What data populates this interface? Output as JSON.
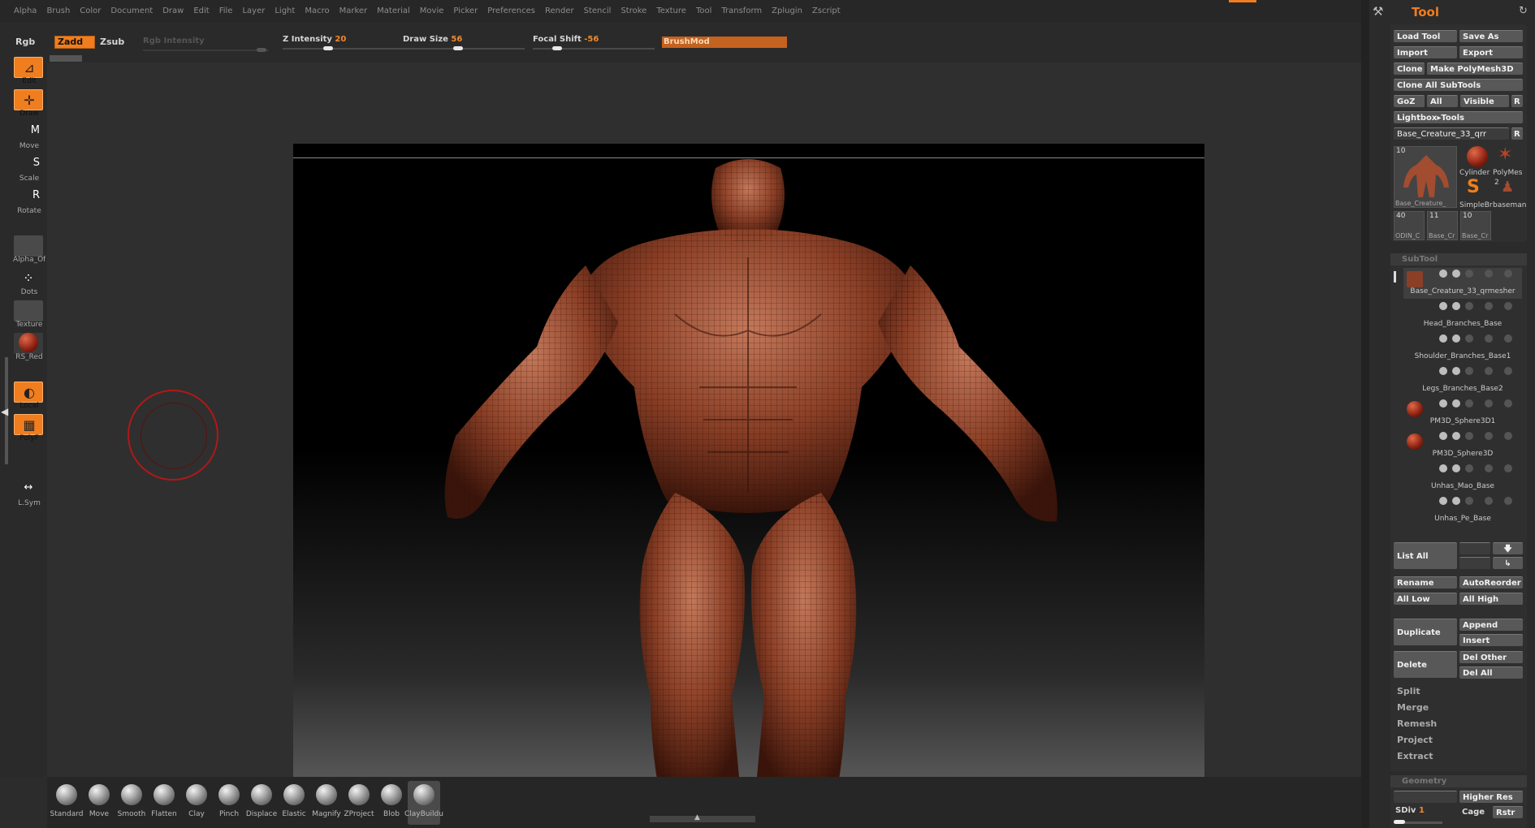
{
  "menu": [
    "Alpha",
    "Brush",
    "Color",
    "Document",
    "Draw",
    "Edit",
    "File",
    "Layer",
    "Light",
    "Macro",
    "Marker",
    "Material",
    "Movie",
    "Picker",
    "Preferences",
    "Render",
    "Stencil",
    "Stroke",
    "Texture",
    "Tool",
    "Transform",
    "Zplugin",
    "Zscript"
  ],
  "topbar": {
    "rgb": "Rgb",
    "zadd": "Zadd",
    "zsub": "Zsub",
    "rgb_intensity": "Rgb Intensity",
    "z_intensity_label": "Z Intensity",
    "z_intensity_value": "20",
    "draw_size_label": "Draw Size",
    "draw_size_value": "56",
    "focal_shift_label": "Focal Shift",
    "focal_shift_value": "-56",
    "brushmod": "BrushMod"
  },
  "left_shelf": [
    {
      "label": "Edit",
      "icon": "edit-icon",
      "glyph": "⊿"
    },
    {
      "label": "Draw",
      "icon": "draw-icon",
      "glyph": "✛"
    },
    {
      "label": "Move",
      "icon": "move-icon",
      "glyph": "M"
    },
    {
      "label": "Scale",
      "icon": "scale-icon",
      "glyph": "S"
    },
    {
      "label": "Rotate",
      "icon": "rotate-icon",
      "glyph": "R"
    },
    {
      "label": "Alpha_Off",
      "icon": "alpha-icon",
      "glyph": ""
    },
    {
      "label": "Dots",
      "icon": "dots-icon",
      "glyph": "⁘"
    },
    {
      "label": "Texture",
      "icon": "texture-icon",
      "glyph": ""
    },
    {
      "label": "RS_Red",
      "icon": "material-icon",
      "glyph": ""
    },
    {
      "label": "Local",
      "icon": "local-icon",
      "glyph": "◐"
    },
    {
      "label": "PolyF",
      "icon": "polyframe-icon",
      "glyph": "▦"
    },
    {
      "label": "L.Sym",
      "icon": "lsym-icon",
      "glyph": "↔"
    }
  ],
  "brushes": [
    "Standard",
    "Move",
    "Smooth",
    "Flatten",
    "Clay",
    "Pinch",
    "Displace",
    "Elastic",
    "Magnify",
    "ZProject",
    "Blob",
    "ClayBuildup"
  ],
  "tool_panel": {
    "title": "Tool",
    "load_tool": "Load Tool",
    "save_as": "Save As",
    "import": "Import",
    "export": "Export",
    "clone": "Clone",
    "make_polymesh": "Make PolyMesh3D",
    "clone_all": "Clone All SubTools",
    "goz": "GoZ",
    "all": "All",
    "visible": "Visible",
    "r": "R",
    "lightbox_tools": "Lightbox▸Tools",
    "current_tool": "Base_Creature_33_qrr",
    "thumbs": [
      {
        "num": "10",
        "name": "Base_Creature_"
      },
      {
        "num": "",
        "name": "Cylinder"
      },
      {
        "num": "",
        "name": "PolyMes"
      },
      {
        "num": "",
        "name": "SimpleBr"
      },
      {
        "num": "2",
        "name": "baseman"
      },
      {
        "num": "40",
        "name": "ODIN_C"
      },
      {
        "num": "11",
        "name": "Base_Cr"
      },
      {
        "num": "10",
        "name": "Base_Cr"
      }
    ],
    "subtool_header": "SubTool",
    "subtools": [
      "Base_Creature_33_qrmesher",
      "Head_Branches_Base",
      "Shoulder_Branches_Base1",
      "Legs_Branches_Base2",
      "PM3D_Sphere3D1",
      "PM3D_Sphere3D",
      "Unhas_Mao_Base",
      "Unhas_Pe_Base"
    ],
    "list_all": "List All",
    "rename": "Rename",
    "autoreorder": "AutoReorder",
    "all_low": "All Low",
    "all_high": "All High",
    "duplicate": "Duplicate",
    "append": "Append",
    "insert": "Insert",
    "delete": "Delete",
    "del_other": "Del Other",
    "del_all": "Del All",
    "split": "Split",
    "merge": "Merge",
    "remesh": "Remesh",
    "project": "Project",
    "extract": "Extract",
    "geometry_header": "Geometry",
    "higher_res": "Higher Res",
    "sdiv_label": "SDiv",
    "sdiv_value": "1",
    "cage": "Cage",
    "rstr": "Rstr"
  },
  "colors": {
    "accent": "#f07d1e",
    "skin": "#8a3f26",
    "skin_light": "#b9674a"
  }
}
